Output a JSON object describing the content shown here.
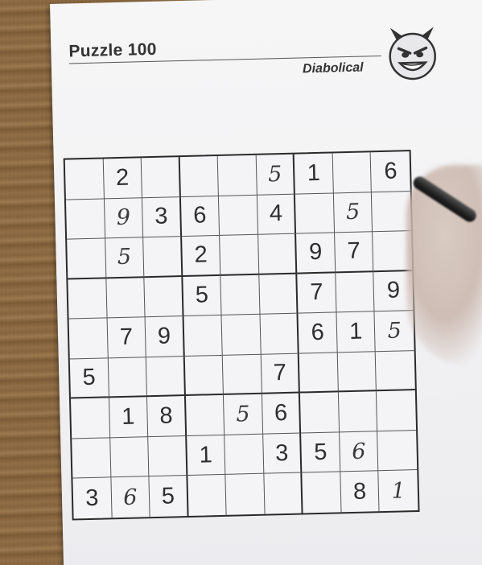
{
  "puzzle": {
    "title": "Puzzle 100",
    "difficulty": "Diabolical"
  },
  "grid": [
    [
      "",
      "2",
      "",
      "",
      "",
      "5",
      "1",
      "",
      "6"
    ],
    [
      "",
      "9",
      "3",
      "6",
      "",
      "4",
      "",
      "5",
      ""
    ],
    [
      "",
      "5",
      "",
      "2",
      "",
      "",
      "9",
      "7",
      ""
    ],
    [
      "",
      "",
      "",
      "5",
      "",
      "",
      "7",
      "",
      "9"
    ],
    [
      "",
      "7",
      "9",
      "",
      "",
      "",
      "6",
      "1",
      "5"
    ],
    [
      "5",
      "",
      "",
      "",
      "",
      "7",
      "",
      "",
      ""
    ],
    [
      "",
      "1",
      "8",
      "",
      "5",
      "6",
      "",
      "",
      ""
    ],
    [
      "",
      "",
      "",
      "1",
      "",
      "3",
      "5",
      "6",
      ""
    ],
    [
      "3",
      "6",
      "5",
      "",
      "",
      "",
      "",
      "8",
      "1"
    ]
  ],
  "handwritten": [
    [
      false,
      false,
      false,
      false,
      false,
      true,
      false,
      false,
      false
    ],
    [
      false,
      true,
      false,
      false,
      false,
      false,
      false,
      true,
      false
    ],
    [
      false,
      true,
      false,
      false,
      false,
      false,
      false,
      false,
      false
    ],
    [
      false,
      false,
      false,
      false,
      false,
      false,
      false,
      false,
      false
    ],
    [
      false,
      false,
      false,
      false,
      false,
      false,
      false,
      false,
      true
    ],
    [
      false,
      false,
      false,
      false,
      false,
      false,
      false,
      false,
      false
    ],
    [
      false,
      false,
      false,
      false,
      true,
      false,
      false,
      false,
      false
    ],
    [
      false,
      false,
      false,
      false,
      false,
      false,
      false,
      true,
      false
    ],
    [
      false,
      true,
      false,
      false,
      false,
      false,
      false,
      false,
      true
    ]
  ],
  "icons": {
    "difficulty_face": "devil-face-icon"
  },
  "colors": {
    "paper": "#f2f2f4",
    "ink": "#2e2e2e",
    "wood": "#8a6a45"
  }
}
